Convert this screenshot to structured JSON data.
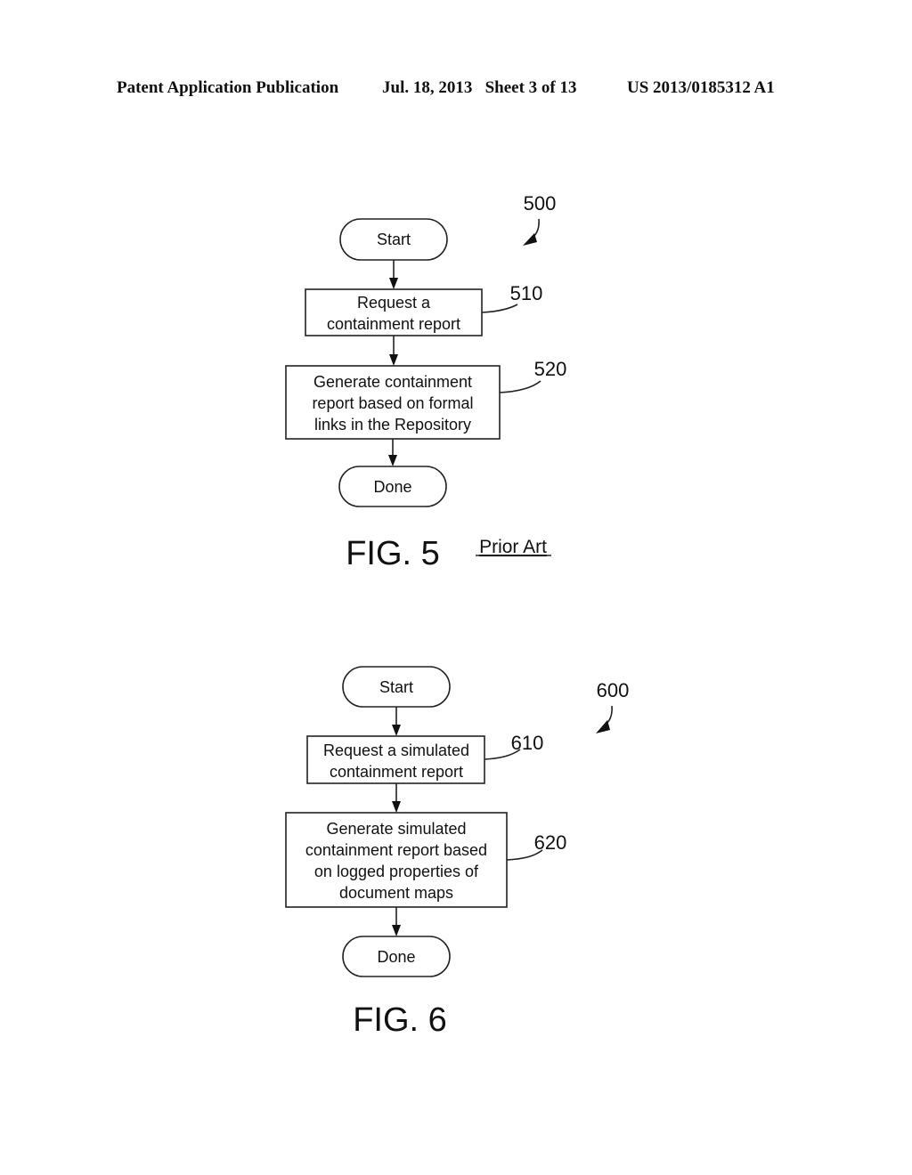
{
  "header": {
    "publication": "Patent Application Publication",
    "date_sheet": "Jul. 18, 2013   Sheet 3 of 13",
    "patent_number": "US 2013/0185312 A1"
  },
  "fig5": {
    "ref": "500",
    "start": "Start",
    "step1": {
      "ref": "510",
      "lines": [
        "Request a",
        "containment report"
      ]
    },
    "step2": {
      "ref": "520",
      "lines": [
        "Generate containment",
        "report based on formal",
        "links in the Repository"
      ]
    },
    "done": "Done",
    "caption": "FIG. 5",
    "note": "Prior Art"
  },
  "fig6": {
    "ref": "600",
    "start": "Start",
    "step1": {
      "ref": "610",
      "lines": [
        "Request a simulated",
        "containment report"
      ]
    },
    "step2": {
      "ref": "620",
      "lines": [
        "Generate simulated",
        "containment report based",
        "on logged properties of",
        "document maps"
      ]
    },
    "done": "Done",
    "caption": "FIG. 6"
  }
}
